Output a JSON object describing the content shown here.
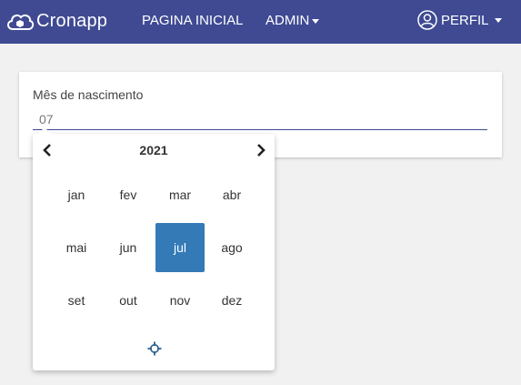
{
  "navbar": {
    "brand": "Cronapp",
    "home_label": "PAGINA INICIAL",
    "admin_label": "ADMIN",
    "profile_label": "PERFIL",
    "background": "#3f4a93"
  },
  "form": {
    "field_label": "Mês de nascimento",
    "field_value": "07"
  },
  "datepicker": {
    "year": "2021",
    "months": [
      "jan",
      "fev",
      "mar",
      "abr",
      "mai",
      "jun",
      "jul",
      "ago",
      "set",
      "out",
      "nov",
      "dez"
    ],
    "selected_month": "jul",
    "selected_color": "#337ab7",
    "prev_icon": "chevron-left-icon",
    "next_icon": "chevron-right-icon",
    "toggle_icon": "crosshair-icon"
  }
}
